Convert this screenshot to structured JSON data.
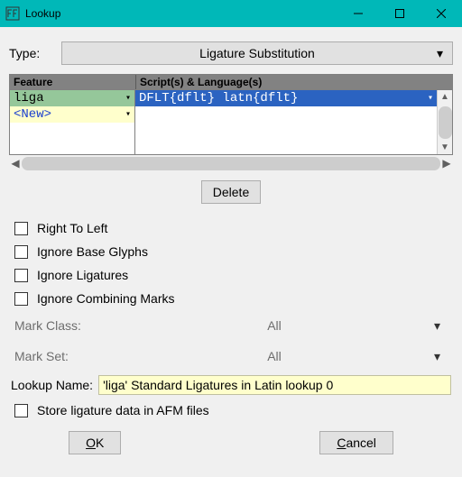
{
  "window": {
    "title": "Lookup"
  },
  "type": {
    "label": "Type:",
    "value": "Ligature Substitution"
  },
  "table": {
    "headers": {
      "feature": "Feature",
      "scripts": "Script(s) & Language(s)"
    },
    "feature_rows": [
      "liga",
      "<New>"
    ],
    "script_rows": [
      "DFLT{dflt} latn{dflt}"
    ]
  },
  "buttons": {
    "delete": "Delete",
    "ok": "OK",
    "ok_mnemonic": "O",
    "ok_rest": "K",
    "cancel": "Cancel",
    "cancel_mnemonic": "C",
    "cancel_rest": "ancel"
  },
  "checks": {
    "rtl": "Right To Left",
    "ignore_base": "Ignore Base Glyphs",
    "ignore_lig": "Ignore Ligatures",
    "ignore_comb": "Ignore Combining Marks",
    "store_afm": "Store ligature data in AFM files"
  },
  "mark": {
    "class_label": "Mark Class:",
    "set_label": "Mark Set:",
    "value": "All"
  },
  "lookup_name": {
    "label": "Lookup Name:",
    "value": "'liga' Standard Ligatures in Latin lookup 0"
  }
}
